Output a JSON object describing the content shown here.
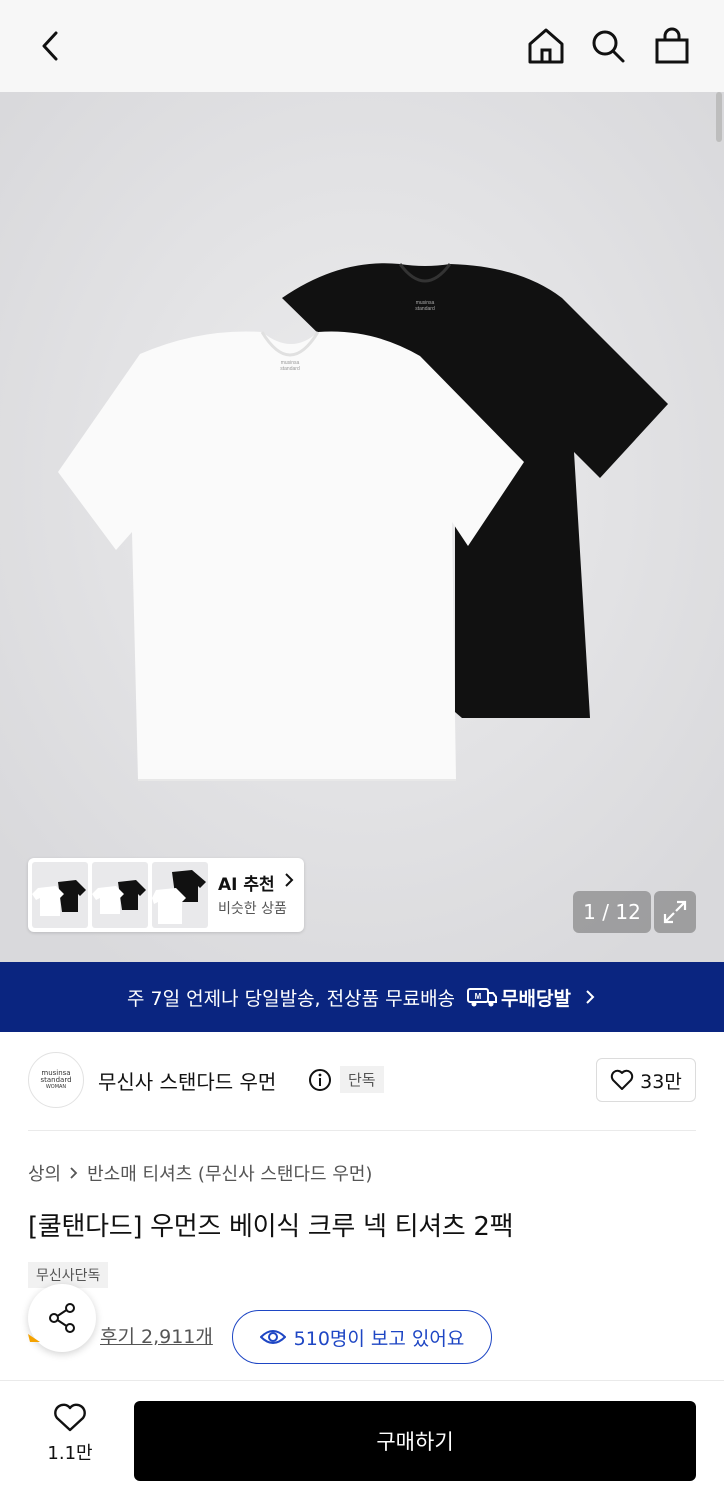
{
  "header": {
    "back_icon": "chevron-left-icon",
    "home_icon": "home-icon",
    "search_icon": "search-icon",
    "cart_icon": "shopping-bag-icon"
  },
  "gallery": {
    "counter": "1 / 12",
    "ai_reco": {
      "title": "AI 추천",
      "subtitle": "비슷한 상품"
    },
    "shirt_labels": {
      "white": [
        "musinsa",
        "standard"
      ],
      "black": [
        "musinsa",
        "standard"
      ]
    }
  },
  "banner": {
    "text": "주 7일 언제나 당일발송, 전상품 무료배송",
    "badge_text": "무배당발",
    "color": "#0a2580"
  },
  "brand": {
    "logo_lines": [
      "musinsa",
      "standard",
      "WOMAN"
    ],
    "name": "무신사 스탠다드 우먼",
    "exclusive_badge": "단독",
    "likes": "33만"
  },
  "product": {
    "breadcrumb": [
      "상의",
      "반소매 티셔츠 (무신사 스탠다드 우먼)"
    ],
    "title": "[쿨탠다드] 우먼즈 베이식 크루 넥 티셔츠 2팩",
    "tag": "무신사단독",
    "reviews": "후기 2,911개",
    "viewing": "510명이 보고 있어요",
    "accent_color": "#1e46c4"
  },
  "bottom": {
    "wish_count": "1.1만",
    "buy_label": "구매하기"
  }
}
